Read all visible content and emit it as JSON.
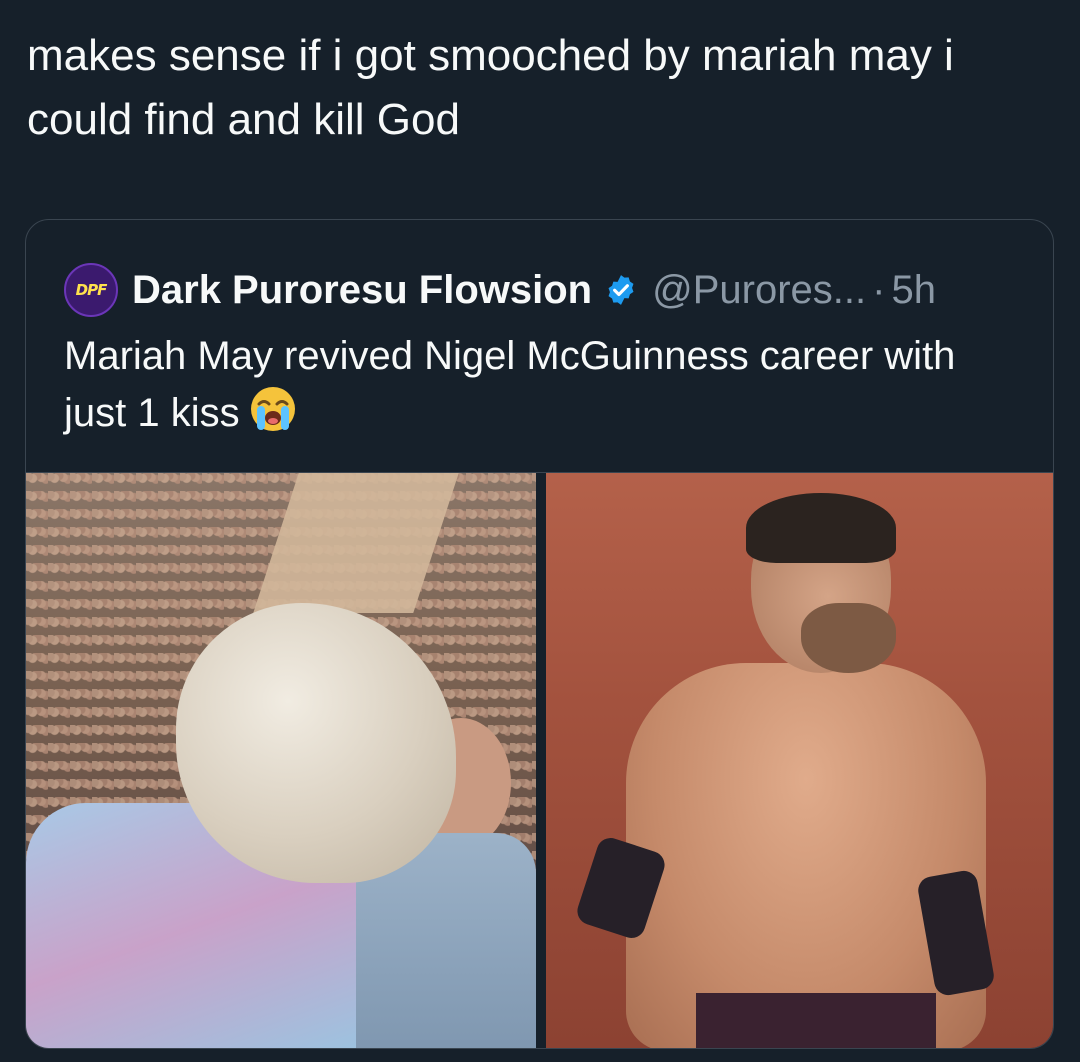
{
  "tweet": {
    "text": "makes sense if i got smooched by mariah may i could find and kill God"
  },
  "quote": {
    "avatar_text": "DPF",
    "display_name": "Dark Puroresu Flowsion",
    "handle": "@Purores...",
    "separator": "·",
    "time": "5h",
    "text": "Mariah May revived Nigel McGuinness career with just 1 kiss",
    "emoji": "loudly-crying-face-emoji"
  },
  "colors": {
    "background": "#16202a",
    "text_primary": "#f7f9f9",
    "text_secondary": "#8b98a5",
    "verified_badge": "#1d9bf0",
    "card_border": "#3a4550"
  }
}
